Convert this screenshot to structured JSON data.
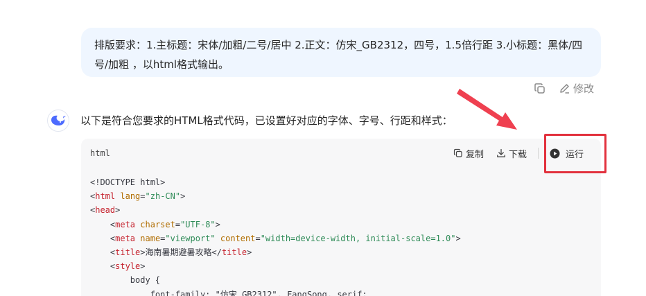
{
  "user_message": {
    "text": "排版要求：1.主标题：宋体/加粗/二号/居中  2.正文：仿宋_GB2312，四号，1.5倍行距 3.小标题：黑体/四号/加粗 ，以html格式输出。",
    "copy_icon": "copy-icon",
    "edit_label": "修改",
    "edit_icon": "edit-icon"
  },
  "assistant": {
    "avatar_icon": "whale-logo-icon",
    "intro": "以下是符合您要求的HTML格式代码，已设置好对应的字体、字号、行距和样式："
  },
  "code_block": {
    "language": "html",
    "copy_label": "复制",
    "download_label": "下载",
    "run_label": "运行",
    "lines": [
      [
        {
          "t": "<!DOCTYPE html>",
          "c": "c-punc"
        }
      ],
      [
        {
          "t": "<",
          "c": "c-punc"
        },
        {
          "t": "html",
          "c": "c-tag"
        },
        {
          "t": " ",
          "c": "c-plain"
        },
        {
          "t": "lang",
          "c": "c-attr"
        },
        {
          "t": "=",
          "c": "c-punc"
        },
        {
          "t": "\"zh-CN\"",
          "c": "c-str"
        },
        {
          "t": ">",
          "c": "c-punc"
        }
      ],
      [
        {
          "t": "<",
          "c": "c-punc"
        },
        {
          "t": "head",
          "c": "c-tag"
        },
        {
          "t": ">",
          "c": "c-punc"
        }
      ],
      [
        {
          "t": "    <",
          "c": "c-punc"
        },
        {
          "t": "meta",
          "c": "c-tag"
        },
        {
          "t": " ",
          "c": "c-plain"
        },
        {
          "t": "charset",
          "c": "c-attr"
        },
        {
          "t": "=",
          "c": "c-punc"
        },
        {
          "t": "\"UTF-8\"",
          "c": "c-str"
        },
        {
          "t": ">",
          "c": "c-punc"
        }
      ],
      [
        {
          "t": "    <",
          "c": "c-punc"
        },
        {
          "t": "meta",
          "c": "c-tag"
        },
        {
          "t": " ",
          "c": "c-plain"
        },
        {
          "t": "name",
          "c": "c-attr"
        },
        {
          "t": "=",
          "c": "c-punc"
        },
        {
          "t": "\"viewport\"",
          "c": "c-str"
        },
        {
          "t": " ",
          "c": "c-plain"
        },
        {
          "t": "content",
          "c": "c-attr"
        },
        {
          "t": "=",
          "c": "c-punc"
        },
        {
          "t": "\"width=device-width, initial-scale=1.0\"",
          "c": "c-str"
        },
        {
          "t": ">",
          "c": "c-punc"
        }
      ],
      [
        {
          "t": "    <",
          "c": "c-punc"
        },
        {
          "t": "title",
          "c": "c-tag"
        },
        {
          "t": ">",
          "c": "c-punc"
        },
        {
          "t": "海南暑期避暑攻略",
          "c": "c-plain"
        },
        {
          "t": "</",
          "c": "c-punc"
        },
        {
          "t": "title",
          "c": "c-tag"
        },
        {
          "t": ">",
          "c": "c-punc"
        }
      ],
      [
        {
          "t": "    <",
          "c": "c-punc"
        },
        {
          "t": "style",
          "c": "c-tag"
        },
        {
          "t": ">",
          "c": "c-punc"
        }
      ],
      [
        {
          "t": "        body {",
          "c": "c-plain"
        }
      ],
      [
        {
          "t": "            font-family: \"仿宋_GB2312\", FangSong, serif;",
          "c": "c-plain"
        }
      ]
    ]
  },
  "annotation": {
    "highlight_color": "#e2313d",
    "arrow_color": "#ef4050"
  }
}
